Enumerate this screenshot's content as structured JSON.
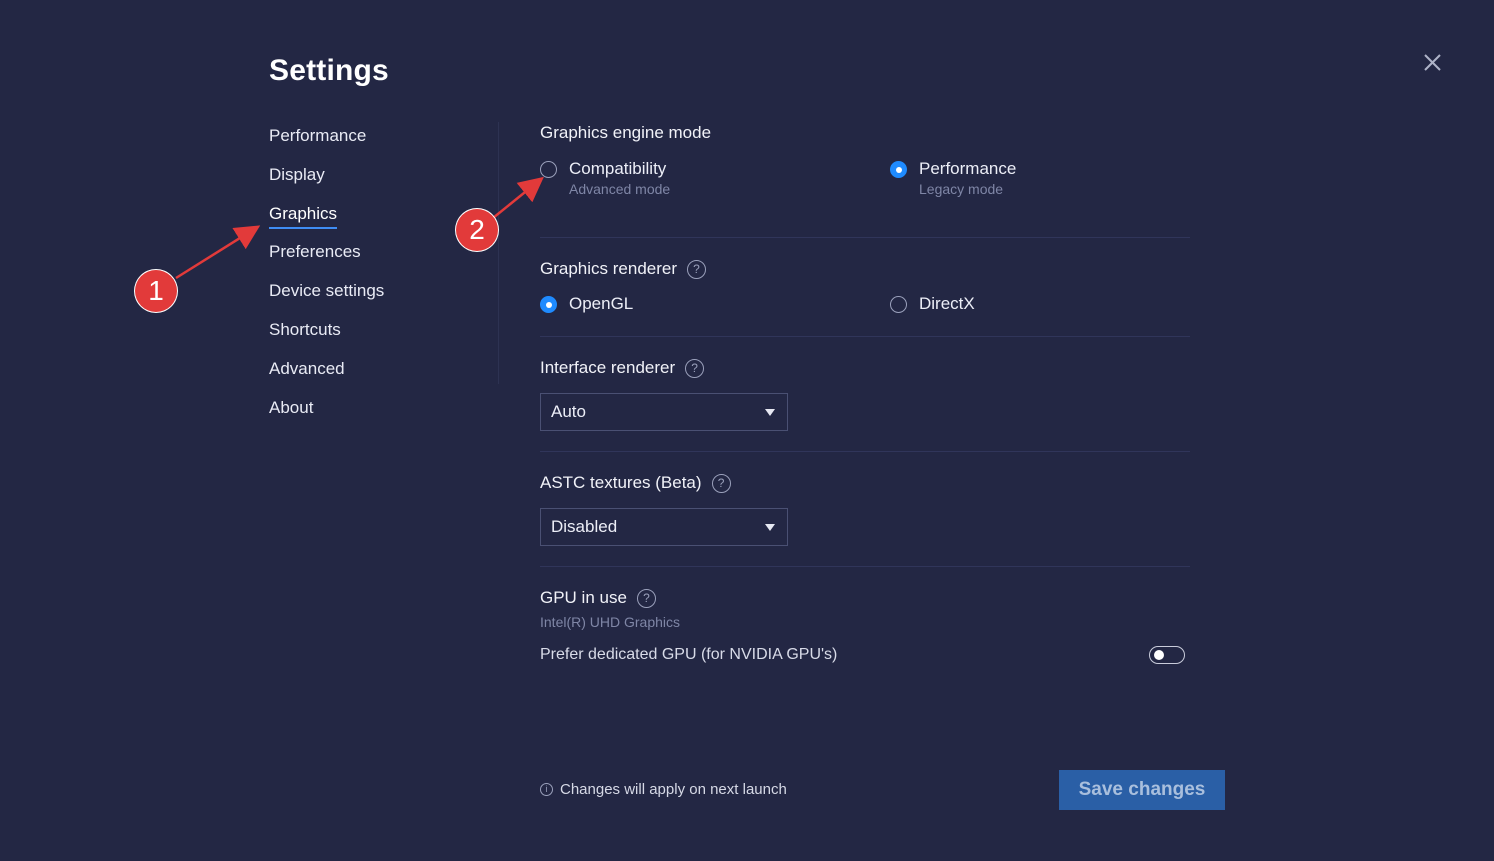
{
  "page": {
    "title": "Settings"
  },
  "nav": {
    "items": [
      {
        "label": "Performance",
        "active": false
      },
      {
        "label": "Display",
        "active": false
      },
      {
        "label": "Graphics",
        "active": true
      },
      {
        "label": "Preferences",
        "active": false
      },
      {
        "label": "Device settings",
        "active": false
      },
      {
        "label": "Shortcuts",
        "active": false
      },
      {
        "label": "Advanced",
        "active": false
      },
      {
        "label": "About",
        "active": false
      }
    ]
  },
  "graphics_engine": {
    "label": "Graphics engine mode",
    "options": [
      {
        "label": "Compatibility",
        "sub": "Advanced mode",
        "selected": false
      },
      {
        "label": "Performance",
        "sub": "Legacy mode",
        "selected": true
      }
    ]
  },
  "graphics_renderer": {
    "label": "Graphics renderer",
    "options": [
      {
        "label": "OpenGL",
        "selected": true
      },
      {
        "label": "DirectX",
        "selected": false
      }
    ]
  },
  "interface_renderer": {
    "label": "Interface renderer",
    "value": "Auto"
  },
  "astc_textures": {
    "label": "ASTC textures (Beta)",
    "value": "Disabled"
  },
  "gpu": {
    "label": "GPU in use",
    "name": "Intel(R) UHD Graphics",
    "prefer_label": "Prefer dedicated GPU (for NVIDIA GPU's)",
    "prefer_enabled": false
  },
  "footer": {
    "note": "Changes will apply on next launch",
    "save_label": "Save changes"
  },
  "icons": {
    "help": "?",
    "info": "i",
    "close": "close-icon"
  },
  "annotations": {
    "badge_1": "1",
    "badge_2": "2"
  },
  "colors": {
    "background": "#232744",
    "accent": "#1f8bff",
    "annotation": "#e23a3a",
    "save_button": "#2a5fa6"
  }
}
